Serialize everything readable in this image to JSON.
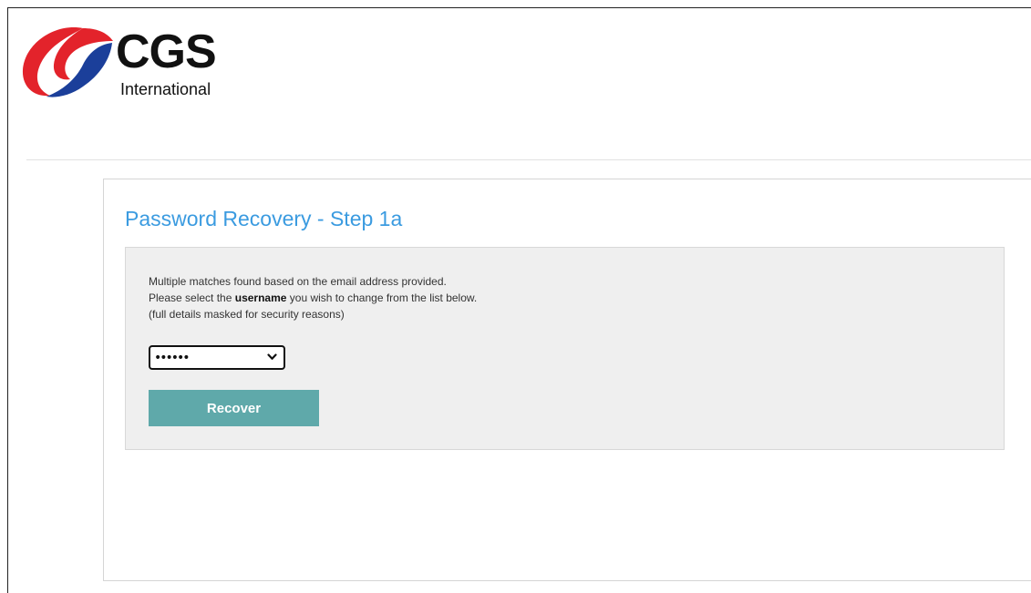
{
  "brand": {
    "name": "CGS",
    "subtitle": "International",
    "logo_icon": "cgs-swirl-logo",
    "colors": {
      "logo_red": "#e3232b",
      "logo_blue": "#1b3f9a"
    }
  },
  "page": {
    "title": "Password Recovery - Step 1a",
    "title_color": "#3b9be0"
  },
  "message": {
    "line1": "Multiple matches found based on the email address provided.",
    "line2_before": "Please select the ",
    "line2_bold": "username",
    "line2_after": " you wish to change from the list below.",
    "line3": "(full details masked for security reasons)"
  },
  "username_select": {
    "selected_value": "••••••",
    "icon": "chevron-down-icon"
  },
  "actions": {
    "recover_label": "Recover",
    "recover_color": "#5fa9aa"
  }
}
